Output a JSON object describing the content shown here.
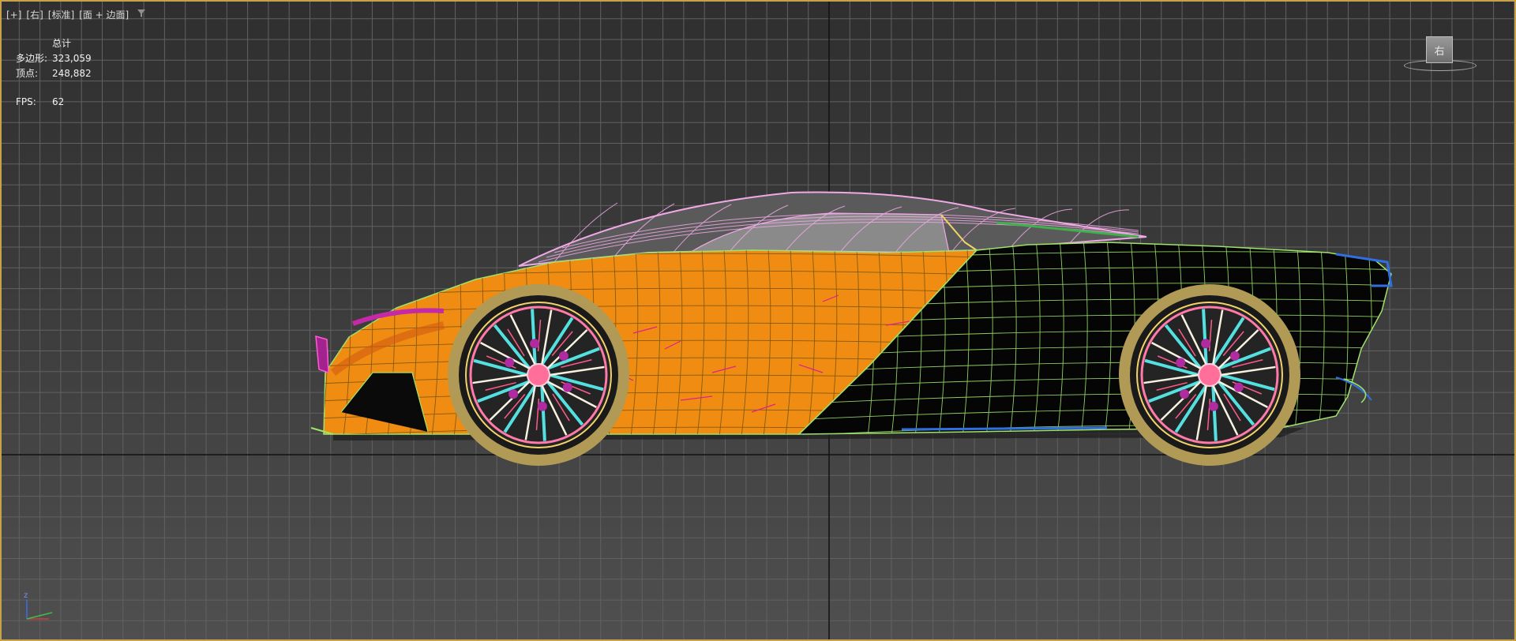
{
  "viewport": {
    "labels": [
      "[+]",
      "[右]",
      "[标准]",
      "[面 + 边面]"
    ],
    "filter_icon": "funnel-icon",
    "border_color": "#c8a24a"
  },
  "stats": {
    "header": "总计",
    "polygons_label": "多边形:",
    "polygons_value": "323,059",
    "vertices_label": "顶点:",
    "vertices_value": "248,882",
    "fps_label": "FPS:",
    "fps_value": "62"
  },
  "viewcube": {
    "face_label": "右"
  },
  "axis": {
    "z_label": "z",
    "icon": "axis-tripod-icon"
  },
  "colors": {
    "body_orange": "#f08c12",
    "body_black": "#050505",
    "wire_green": "#9fe36a",
    "roof_pink": "#f0a9e6",
    "wire_blue": "#2f6fe0",
    "rim_pink": "#ff7aa8",
    "spoke_cyan": "#54e0e0",
    "tire_gold": "#b09a55"
  }
}
